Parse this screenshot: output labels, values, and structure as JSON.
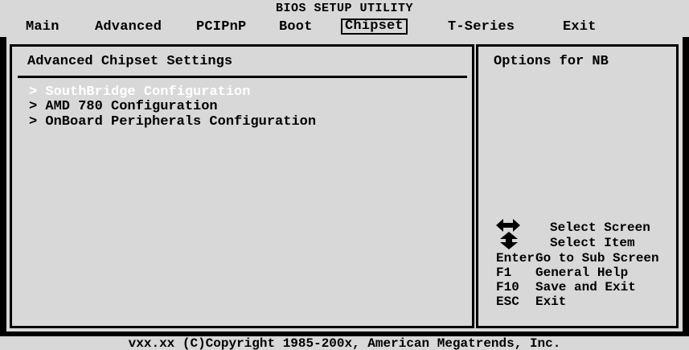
{
  "window_title": "BIOS SETUP UTILITY",
  "menu": {
    "main": "Main",
    "advanced": "Advanced",
    "pcipnp": "PCIPnP",
    "boot": "Boot",
    "chipset": "Chipset",
    "tseries": "T-Series",
    "exit": "Exit"
  },
  "section": {
    "title": "Advanced Chipset Settings",
    "options": [
      {
        "label": "> SouthBridge Configuration",
        "selected": true
      },
      {
        "label": "> AMD 780 Configuration",
        "selected": false
      },
      {
        "label": "> OnBoard Peripherals Configuration",
        "selected": false
      }
    ]
  },
  "help": {
    "text": "Options for NB",
    "keys": [
      {
        "key": "",
        "desc": "Select Screen",
        "icon": "left-right-arrow-icon"
      },
      {
        "key": "",
        "desc": "Select Item",
        "icon": "up-down-arrow-icon"
      },
      {
        "key": "Enter",
        "desc": "Go to Sub Screen"
      },
      {
        "key": "F1",
        "desc": "General Help"
      },
      {
        "key": "F10",
        "desc": "Save and Exit"
      },
      {
        "key": "ESC",
        "desc": "Exit"
      }
    ]
  },
  "footer": "vxx.xx (C)Copyright 1985-200x, American Megatrends, Inc.",
  "colors": {
    "background": "#000000",
    "panel": "#d8d8d8",
    "selected_text": "#ffffff"
  }
}
